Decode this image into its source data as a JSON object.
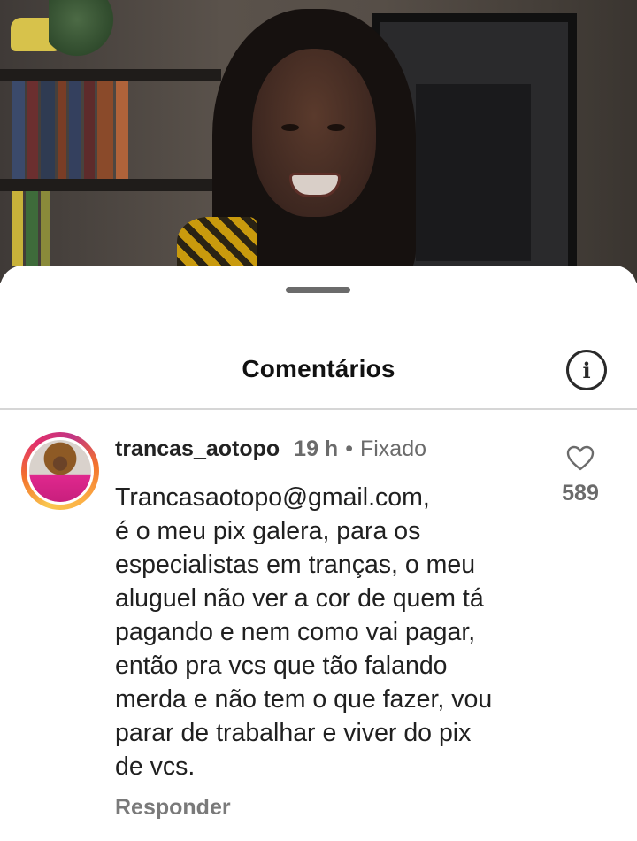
{
  "sheet": {
    "title": "Comentários",
    "info_icon": "info-icon"
  },
  "comment": {
    "username": "trancas_aotopo",
    "time": "19 h",
    "separator": "•",
    "pinned_label": "Fixado",
    "text_lines": [
      "Trancasaotopo@gmail.com,",
      "é o meu pix galera, para os",
      "especialistas em tranças, o meu",
      "aluguel não ver a cor de quem tá",
      "pagando e nem como vai pagar,",
      "então pra vcs que tão falando",
      "merda e não tem o que fazer, vou",
      "parar de trabalhar e viver do pix",
      "de vcs."
    ],
    "like_count": "589",
    "like_icon": "heart-outline-icon",
    "reply_label": "Responder"
  },
  "colors": {
    "avatar_ring": [
      "#f9c74f",
      "#e1306c",
      "#c13584"
    ],
    "muted_text": "#6b6b6b",
    "primary_text": "#202020"
  }
}
